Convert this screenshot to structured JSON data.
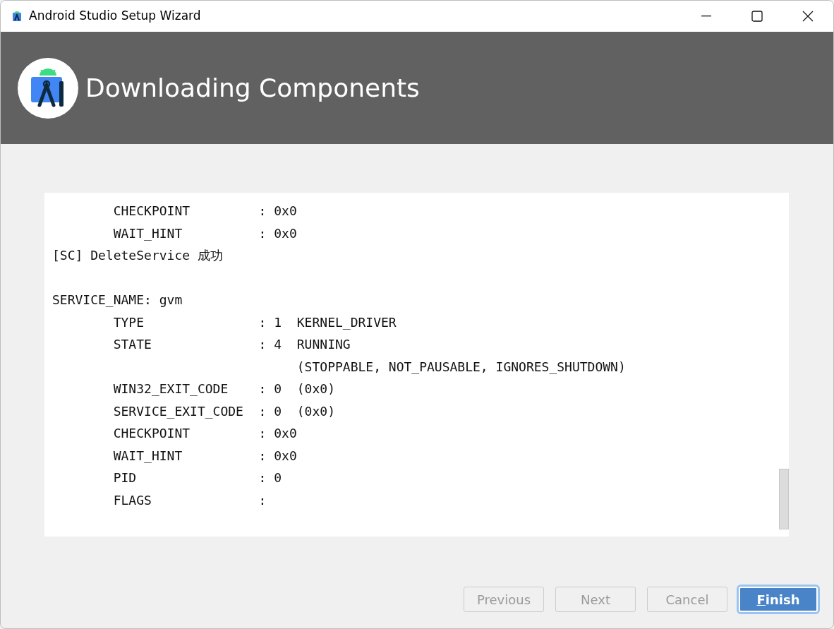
{
  "window": {
    "title": "Android Studio Setup Wizard"
  },
  "header": {
    "title": "Downloading Components"
  },
  "log": {
    "blocks": [
      [
        "        CHECKPOINT         : 0x0",
        "        WAIT_HINT          : 0x0",
        "[SC] DeleteService 成功"
      ],
      [
        "SERVICE_NAME: gvm",
        "        TYPE               : 1  KERNEL_DRIVER",
        "        STATE              : 4  RUNNING",
        "                                (STOPPABLE, NOT_PAUSABLE, IGNORES_SHUTDOWN)",
        "        WIN32_EXIT_CODE    : 0  (0x0)",
        "        SERVICE_EXIT_CODE  : 0  (0x0)",
        "        CHECKPOINT         : 0x0",
        "        WAIT_HINT          : 0x0",
        "        PID                : 0",
        "        FLAGS              :"
      ]
    ]
  },
  "buttons": [
    {
      "label": "Previous",
      "disabled": true,
      "default": false
    },
    {
      "label": "Next",
      "disabled": true,
      "default": false
    },
    {
      "label": "Cancel",
      "disabled": true,
      "default": false
    },
    {
      "label": "Finish",
      "disabled": false,
      "default": true,
      "first_letter_underlined": true
    }
  ]
}
